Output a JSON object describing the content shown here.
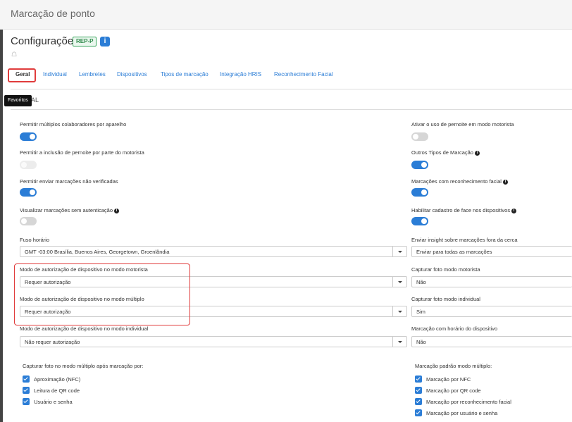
{
  "header": {
    "title": "Marcação de ponto"
  },
  "page": {
    "heading": "Configurações",
    "badge": "REP-P",
    "info": "i",
    "home_icon": "home-icon"
  },
  "tabs": [
    {
      "label": "Geral",
      "active": true
    },
    {
      "label": "Individual"
    },
    {
      "label": "Lembretes"
    },
    {
      "label": "Dispositivos"
    },
    {
      "label": "Tipos de marcação"
    },
    {
      "label": "Integração HRIS"
    },
    {
      "label": "Reconhecimento Facial"
    }
  ],
  "tooltip": "Favoritos",
  "section": "AL",
  "left_toggles": [
    {
      "label": "Permitir múltiplos colaboradores por aparelho",
      "state": "on"
    },
    {
      "label": "Permitir a inclusão de pernoite por parte do motorista",
      "state": "disabled"
    },
    {
      "label": "Permitir enviar marcações não verificadas",
      "state": "on"
    },
    {
      "label": "Visualizar marcações sem autenticação",
      "state": "off",
      "info": true
    }
  ],
  "right_toggles": [
    {
      "label": "Ativar o uso de pernoite em modo motorista",
      "state": "off"
    },
    {
      "label": "Outros Tipos de Marcação",
      "state": "on",
      "info": true
    },
    {
      "label": "Marcações com reconhecimento facial",
      "state": "on",
      "info": true
    },
    {
      "label": "Habilitar cadastro de face nos dispositivos",
      "state": "on",
      "info": true
    }
  ],
  "left_selects": [
    {
      "label": "Fuso horário",
      "value": "GMT -03:00 Brasília, Buenos Aires, Georgetown, Groenlândia"
    },
    {
      "label": "Modo de autorização de dispositivo no modo motorista",
      "value": "Requer autorização"
    },
    {
      "label": "Modo de autorização de dispositivo no modo múltiplo",
      "value": "Requer autorização"
    },
    {
      "label": "Modo de autorização de dispositivo no modo individual",
      "value": "Não requer autorização"
    }
  ],
  "right_selects": [
    {
      "label": "Enviar insight sobre marcações fora da cerca",
      "value": "Enviar para todas as marcações"
    },
    {
      "label": "Capturar foto modo motorista",
      "value": "Não"
    },
    {
      "label": "Capturar foto modo individual",
      "value": "Sim"
    },
    {
      "label": "Marcação com horário do dispositivo",
      "value": "Não"
    }
  ],
  "left_checks": {
    "title": "Capturar foto no modo múltiplo após marcação por:",
    "items": [
      "Aproximação (NFC)",
      "Leitura de QR code",
      "Usuário e senha"
    ]
  },
  "right_checks": {
    "title": "Marcação padrão modo múltiplo:",
    "items": [
      "Marcação por NFC",
      "Marcação por QR code",
      "Marcação por reconhecimento facial",
      "Marcação por usuário e senha"
    ]
  },
  "colors": {
    "accent": "#2b7dd6",
    "highlight": "#e03c3c",
    "badge": "#3aa55d"
  }
}
